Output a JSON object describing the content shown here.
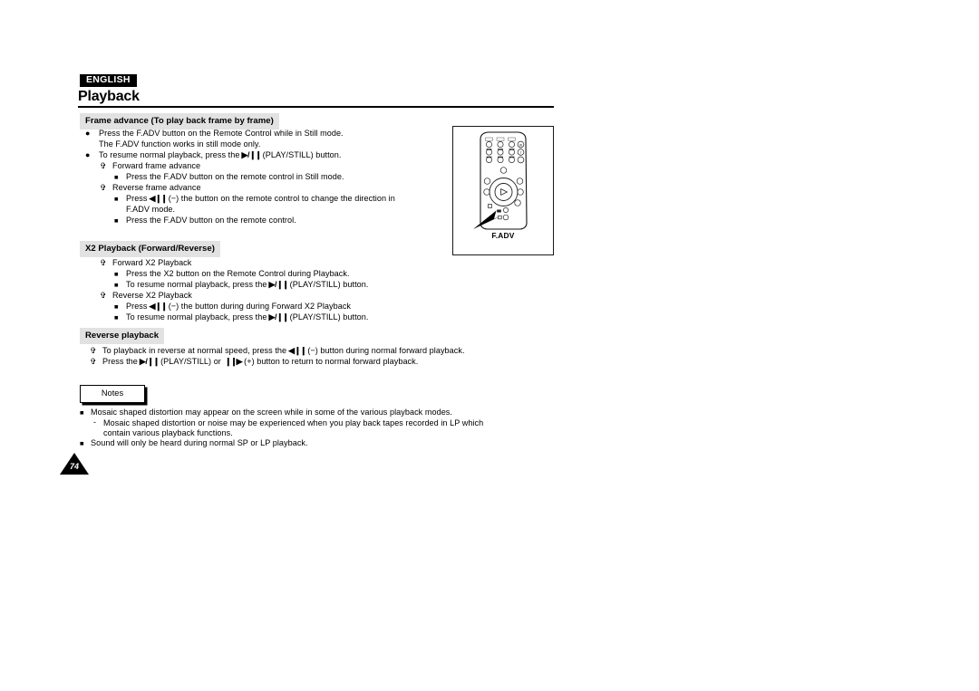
{
  "header": {
    "language_badge": "ENGLISH",
    "title": "Playback"
  },
  "sections": [
    {
      "id": "frame-advance",
      "heading": "Frame advance (To play back frame by frame)",
      "lines": [
        {
          "bullet": "dot",
          "indent": 0,
          "text": "Press the F.ADV button on the Remote Control while in Still mode."
        },
        {
          "bullet": "none",
          "indent": 0,
          "text": "The F.ADV function works in still mode only."
        },
        {
          "bullet": "dot",
          "indent": 0,
          "text_pre": "To resume normal playback, press the",
          "icon": "play-still",
          "text_post": "(PLAY/STILL) button."
        },
        {
          "bullet": "club",
          "indent": 1,
          "text": "Forward frame advance"
        },
        {
          "bullet": "sq",
          "indent": 2,
          "text": "Press the F.ADV button on the remote control in Still mode."
        },
        {
          "bullet": "club",
          "indent": 1,
          "text": "Reverse frame advance"
        },
        {
          "bullet": "sq",
          "indent": 2,
          "text_pre": "Press",
          "icon": "rew-still",
          "text_post": "(−) the button on the remote control to change the direction in"
        },
        {
          "bullet": "none",
          "indent": 2,
          "text": "F.ADV mode."
        },
        {
          "bullet": "sq",
          "indent": 2,
          "text": "Press the F.ADV button on the remote control."
        }
      ]
    },
    {
      "id": "x2-playback",
      "heading": "X2 Playback (Forward/Reverse)",
      "lines": [
        {
          "bullet": "club",
          "indent": 1,
          "text": "Forward X2 Playback"
        },
        {
          "bullet": "sq",
          "indent": 2,
          "text": "Press the X2 button on the Remote Control during Playback."
        },
        {
          "bullet": "sq",
          "indent": 2,
          "text_pre": "To resume normal playback, press the",
          "icon": "play-still",
          "text_post": "(PLAY/STILL) button."
        },
        {
          "bullet": "club",
          "indent": 1,
          "text": "Reverse X2 Playback"
        },
        {
          "bullet": "sq",
          "indent": 2,
          "text_pre": "Press",
          "icon": "rew-still",
          "text_post": "(−) the button during during Forward X2 Playback"
        },
        {
          "bullet": "sq",
          "indent": 2,
          "text_pre": "To resume normal playback, press the",
          "icon": "play-still",
          "text_post": "(PLAY/STILL) button."
        }
      ]
    },
    {
      "id": "reverse-playback",
      "heading": "Reverse playback",
      "lines": [
        {
          "bullet": "club",
          "indent": 1,
          "text_pre": "To playback in reverse at normal speed, press the",
          "icon": "rew-still",
          "text_post": "(−) button during normal forward playback."
        },
        {
          "bullet": "club",
          "indent": 1,
          "text_pre": "Press the",
          "icon": "play-still",
          "text_mid": "(PLAY/STILL) or",
          "icon2": "ff-still",
          "text_post": "(+) button to return to normal forward playback."
        }
      ]
    }
  ],
  "notes": {
    "label": "Notes",
    "lines": [
      {
        "bullet": "sq",
        "indent": 0,
        "text": "Mosaic shaped distortion may appear on the screen while in some of the various playback modes."
      },
      {
        "bullet": "dash",
        "indent": 1,
        "text": "Mosaic shaped distortion or noise may be experienced when you play back tapes recorded in LP which"
      },
      {
        "bullet": "none",
        "indent": 1,
        "text": "contain various playback functions."
      },
      {
        "bullet": "sq",
        "indent": 0,
        "text": "Sound will only be heard during normal SP or LP playback."
      }
    ]
  },
  "illustration": {
    "caption": "F.ADV",
    "alt": "remote-control-diagram"
  },
  "footer": {
    "page_number": "74"
  },
  "icons": {
    "play_still": "▶/❙❙",
    "rew_still": "◀❙❙",
    "ff_still": "❙❙▶"
  },
  "colors": {
    "text": "#000000",
    "section_heading_bg": "#e2e2e2",
    "badge_bg": "#000000",
    "badge_text": "#ffffff",
    "page": "#ffffff"
  }
}
